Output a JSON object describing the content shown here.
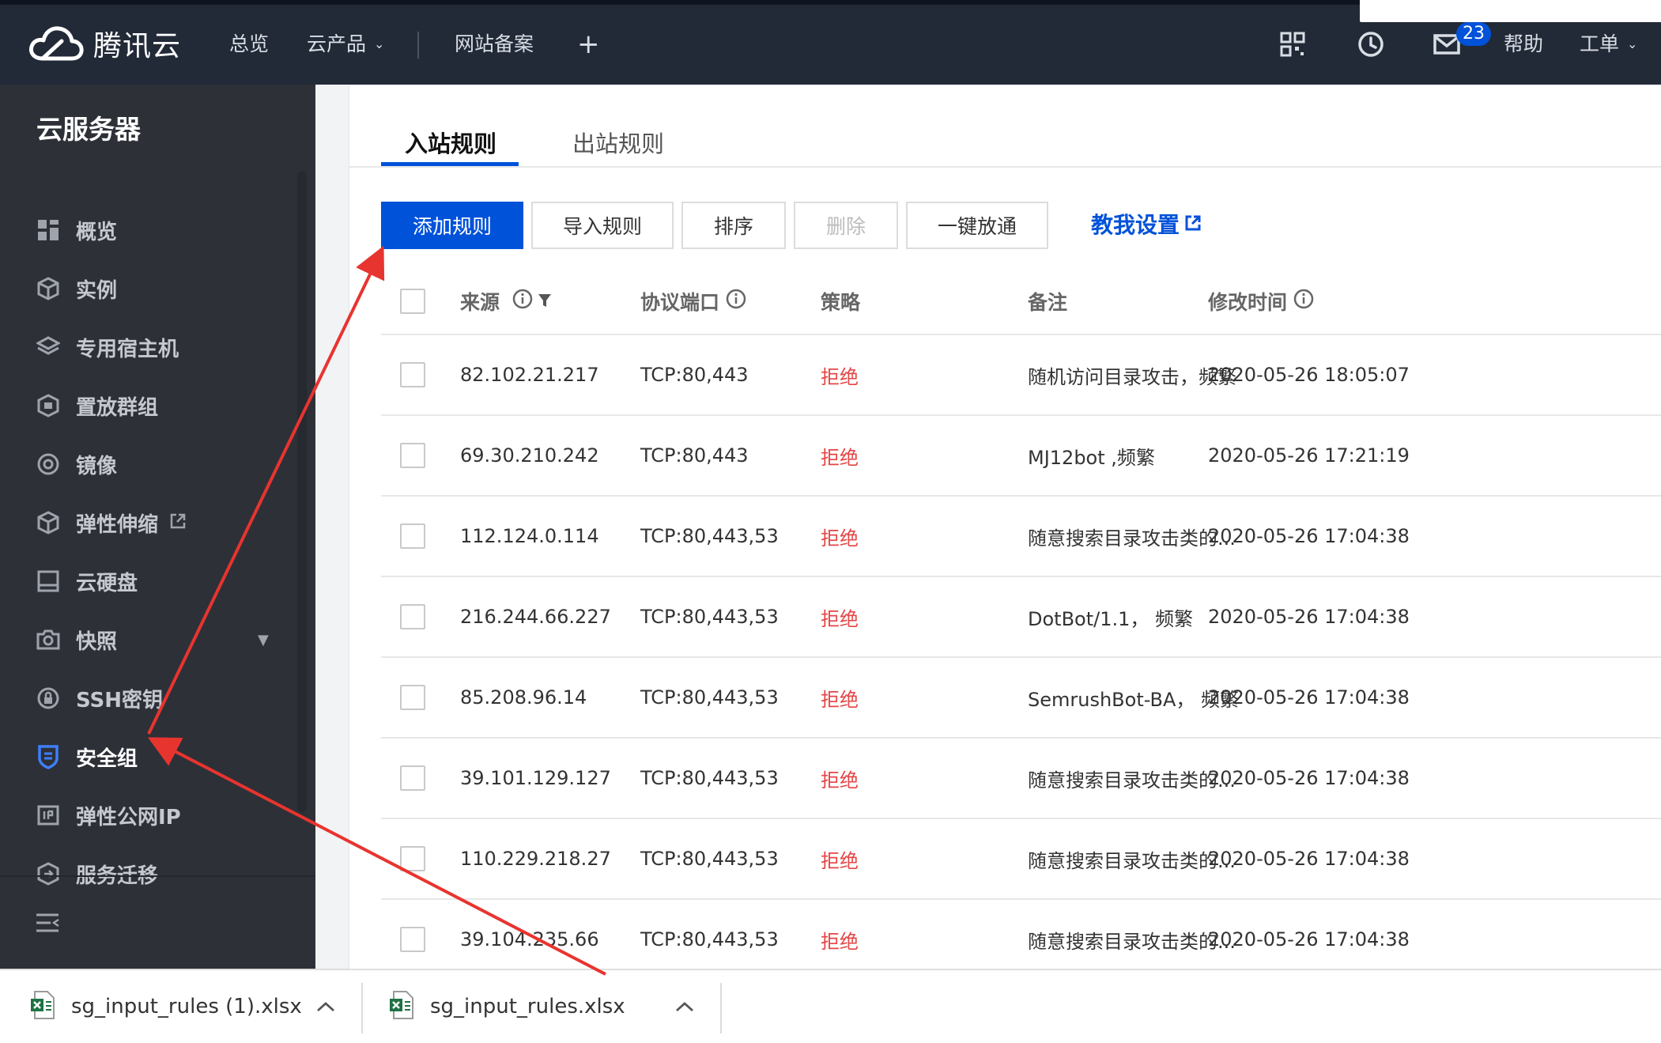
{
  "brand": {
    "logo_text": "腾讯云"
  },
  "topnav": {
    "overview": "总览",
    "products": "云产品",
    "icp": "网站备案",
    "plus": "+",
    "help": "帮助",
    "ticket": "工单",
    "mail_badge": "23"
  },
  "sidebar": {
    "title": "云服务器",
    "items": [
      {
        "label": "概览",
        "icon": "grid-icon"
      },
      {
        "label": "实例",
        "icon": "cube-icon"
      },
      {
        "label": "专用宿主机",
        "icon": "layers-icon"
      },
      {
        "label": "置放群组",
        "icon": "hex-group-icon"
      },
      {
        "label": "镜像",
        "icon": "disc-icon"
      },
      {
        "label": "弹性伸缩",
        "icon": "scaling-icon"
      },
      {
        "label": "云硬盘",
        "icon": "disk-icon"
      },
      {
        "label": "快照",
        "icon": "camera-icon"
      },
      {
        "label": "SSH密钥",
        "icon": "key-icon"
      },
      {
        "label": "安全组",
        "icon": "shield-icon"
      },
      {
        "label": "弹性公网IP",
        "icon": "ip-icon"
      },
      {
        "label": "服务迁移",
        "icon": "migrate-icon"
      }
    ],
    "active_index": 9
  },
  "tabs": {
    "inbound": "入站规则",
    "outbound": "出站规则"
  },
  "toolbar": {
    "add": "添加规则",
    "import": "导入规则",
    "sort": "排序",
    "delete": "删除",
    "open_all": "一键放通",
    "help_link": "教我设置"
  },
  "table": {
    "headers": {
      "source": "来源",
      "port": "协议端口",
      "policy": "策略",
      "remark": "备注",
      "modified": "修改时间"
    },
    "rows": [
      {
        "source": "82.102.21.217",
        "port": "TCP:80,443",
        "policy": "拒绝",
        "remark": "随机访问目录攻击，频繁",
        "modified": "2020-05-26 18:05:07"
      },
      {
        "source": "69.30.210.242",
        "port": "TCP:80,443",
        "policy": "拒绝",
        "remark": "MJ12bot ,频繁",
        "modified": "2020-05-26 17:21:19"
      },
      {
        "source": "112.124.0.114",
        "port": "TCP:80,443,53",
        "policy": "拒绝",
        "remark": "随意搜索目录攻击类的...",
        "modified": "2020-05-26 17:04:38"
      },
      {
        "source": "216.244.66.227",
        "port": "TCP:80,443,53",
        "policy": "拒绝",
        "remark": "DotBot/1.1， 频繁",
        "modified": "2020-05-26 17:04:38"
      },
      {
        "source": "85.208.96.14",
        "port": "TCP:80,443,53",
        "policy": "拒绝",
        "remark": "SemrushBot-BA， 频繁",
        "modified": "2020-05-26 17:04:38"
      },
      {
        "source": "39.101.129.127",
        "port": "TCP:80,443,53",
        "policy": "拒绝",
        "remark": "随意搜索目录攻击类的...",
        "modified": "2020-05-26 17:04:38"
      },
      {
        "source": "110.229.218.27",
        "port": "TCP:80,443,53",
        "policy": "拒绝",
        "remark": "随意搜索目录攻击类的...",
        "modified": "2020-05-26 17:04:38"
      },
      {
        "source": "39.104.235.66",
        "port": "TCP:80,443,53",
        "policy": "拒绝",
        "remark": "随意搜索目录攻击类的...",
        "modified": "2020-05-26 17:04:38"
      }
    ]
  },
  "downloads": [
    {
      "name": "sg_input_rules (1).xlsx"
    },
    {
      "name": "sg_input_rules.xlsx"
    }
  ],
  "colors": {
    "topbar": "#222a38",
    "sidebar": "#2d3037",
    "primary": "#0052d9",
    "deny": "#e54545",
    "annotation": "#e8342f"
  }
}
